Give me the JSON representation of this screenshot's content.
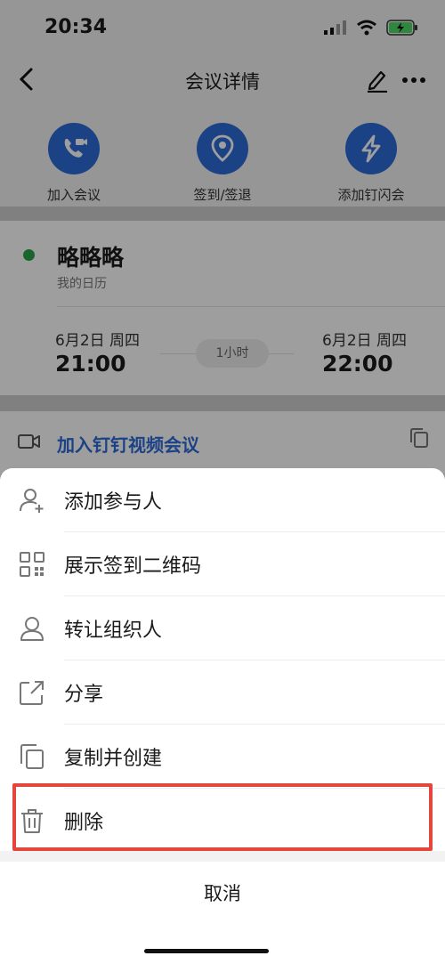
{
  "status_bar": {
    "time": "20:34"
  },
  "header": {
    "title": "会议详情"
  },
  "quick_actions": [
    {
      "label": "加入会议",
      "icon": "phone-video-icon"
    },
    {
      "label": "签到/签退",
      "icon": "location-pin-icon"
    },
    {
      "label": "添加钉闪会",
      "icon": "lightning-icon"
    }
  ],
  "event": {
    "title": "略略略",
    "calendar": "我的日历",
    "start_date": "6月2日 周四",
    "start_time": "21:00",
    "duration": "1小时",
    "end_date": "6月2日 周四",
    "end_time": "22:00"
  },
  "video": {
    "link_label": "加入钉钉视频会议"
  },
  "menu": {
    "items": [
      {
        "label": "添加参与人",
        "icon": "add-person-icon"
      },
      {
        "label": "展示签到二维码",
        "icon": "qr-code-icon"
      },
      {
        "label": "转让组织人",
        "icon": "person-icon"
      },
      {
        "label": "分享",
        "icon": "share-icon"
      },
      {
        "label": "复制并创建",
        "icon": "copy-icon"
      },
      {
        "label": "删除",
        "icon": "trash-icon"
      }
    ],
    "cancel": "取消"
  },
  "colors": {
    "accent": "#2e6bd9",
    "green_dot": "#2aa44a",
    "highlight": "#e5463b"
  }
}
